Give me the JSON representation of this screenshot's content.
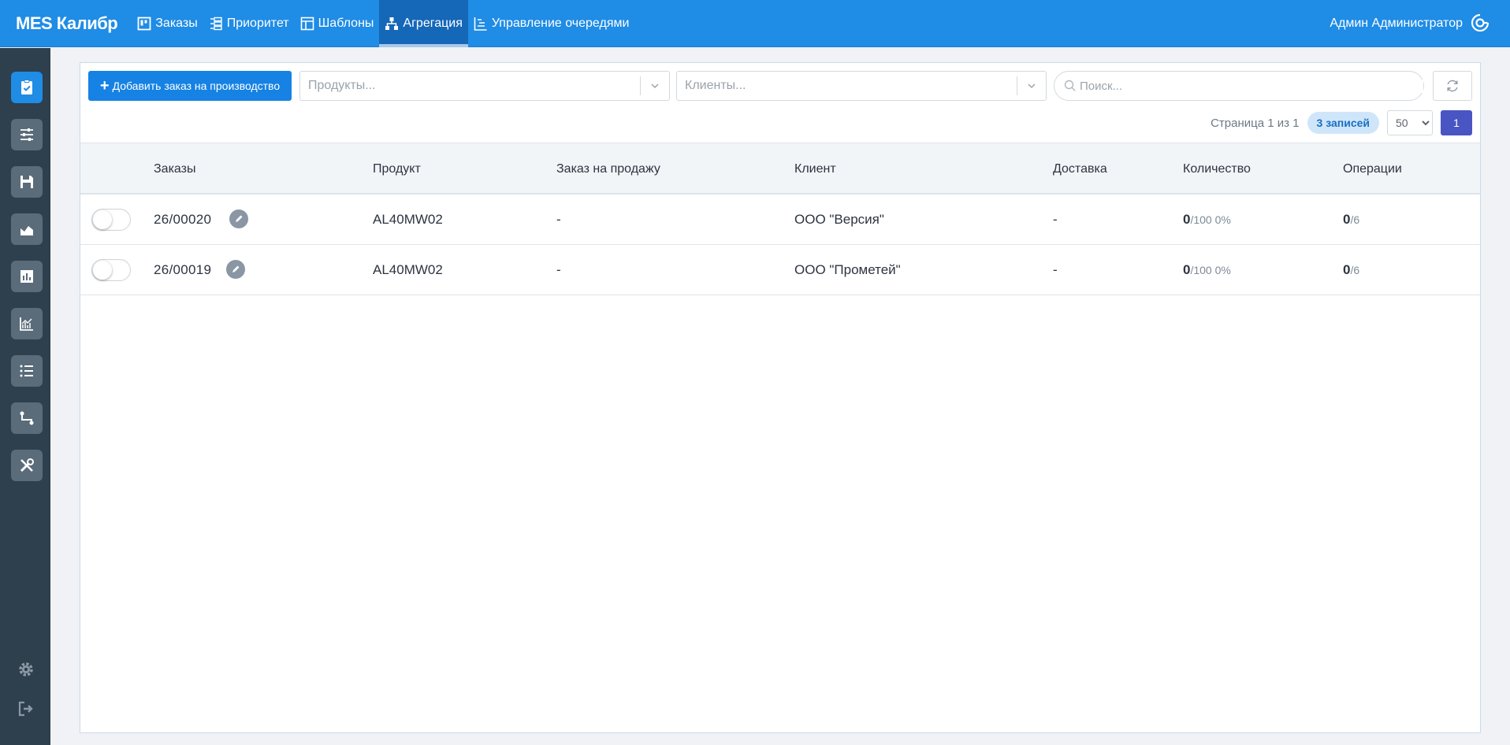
{
  "app": {
    "brand": "MES Калибр",
    "nav": [
      {
        "label": "Заказы",
        "icon": "kanban-icon"
      },
      {
        "label": "Приоритет",
        "icon": "priority-icon"
      },
      {
        "label": "Шаблоны",
        "icon": "template-icon"
      },
      {
        "label": "Агрегация",
        "icon": "aggregation-icon",
        "active": true
      },
      {
        "label": "Управление очередями",
        "icon": "queue-icon"
      }
    ],
    "user": "Админ Администратор",
    "accent": "#1f8ce6"
  },
  "sidebar": {
    "items": [
      "orders-check-icon",
      "sliders-icon",
      "save-icon",
      "area-chart-icon",
      "bar-chart-icon",
      "line-chart-icon",
      "list-icon",
      "route-icon",
      "tools-icon"
    ],
    "bottom": [
      "gear-icon",
      "logout-icon"
    ]
  },
  "toolbar": {
    "add_label": "Добавить заказ на производство",
    "products_placeholder": "Продукты...",
    "clients_placeholder": "Клиенты...",
    "search_placeholder": "Поиск..."
  },
  "pager": {
    "page_text": "Страница 1 из 1",
    "records": "3 записей",
    "per_page": "50",
    "per_page_options": [
      "50"
    ],
    "current_page": "1"
  },
  "table": {
    "columns": [
      "Заказы",
      "Продукт",
      "Заказ на продажу",
      "Клиент",
      "Доставка",
      "Количество",
      "Операции"
    ],
    "rows": [
      {
        "order": "26/00020",
        "product": "AL40MW02",
        "sale": "-",
        "client": "ООО \"Версия\"",
        "delivery": "-",
        "qty_done": "0",
        "qty_total": "/100 0%",
        "ops_done": "0",
        "ops_total": "/6"
      },
      {
        "order": "26/00019",
        "product": "AL40MW02",
        "sale": "-",
        "client": "ООО \"Прометей\"",
        "delivery": "-",
        "qty_done": "0",
        "qty_total": "/100 0%",
        "ops_done": "0",
        "ops_total": "/6"
      }
    ]
  }
}
